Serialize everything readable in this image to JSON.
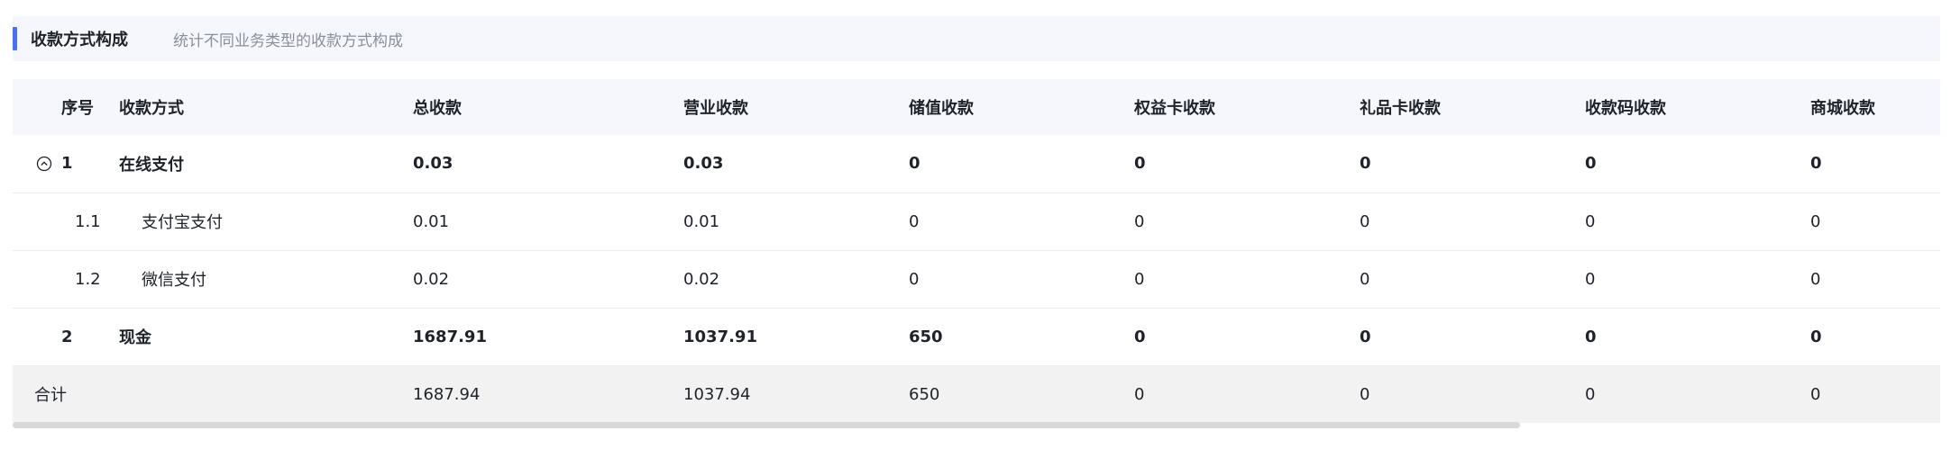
{
  "section": {
    "title": "收款方式构成",
    "subtitle": "统计不同业务类型的收款方式构成",
    "accent_color": "#4e6ef2"
  },
  "table": {
    "headers": [
      "序号",
      "收款方式",
      "总收款",
      "营业收款",
      "储值收款",
      "权益卡收款",
      "礼品卡收款",
      "收款码收款",
      "商城收款"
    ],
    "rows": [
      {
        "idx": "1",
        "method": "在线支付",
        "total": "0.03",
        "business": "0.03",
        "stored": "0",
        "equity": "0",
        "gift": "0",
        "code": "0",
        "mall": "0"
      },
      {
        "idx": "1.1",
        "method": "支付宝支付",
        "total": "0.01",
        "business": "0.01",
        "stored": "0",
        "equity": "0",
        "gift": "0",
        "code": "0",
        "mall": "0"
      },
      {
        "idx": "1.2",
        "method": "微信支付",
        "total": "0.02",
        "business": "0.02",
        "stored": "0",
        "equity": "0",
        "gift": "0",
        "code": "0",
        "mall": "0"
      },
      {
        "idx": "2",
        "method": "现金",
        "total": "1687.91",
        "business": "1037.91",
        "stored": "650",
        "equity": "0",
        "gift": "0",
        "code": "0",
        "mall": "0"
      }
    ],
    "totals": {
      "label": "合计",
      "total": "1687.94",
      "business": "1037.94",
      "stored": "650",
      "equity": "0",
      "gift": "0",
      "code": "0",
      "mall": "0"
    },
    "expand_icon": "collapse-circle-icon"
  }
}
